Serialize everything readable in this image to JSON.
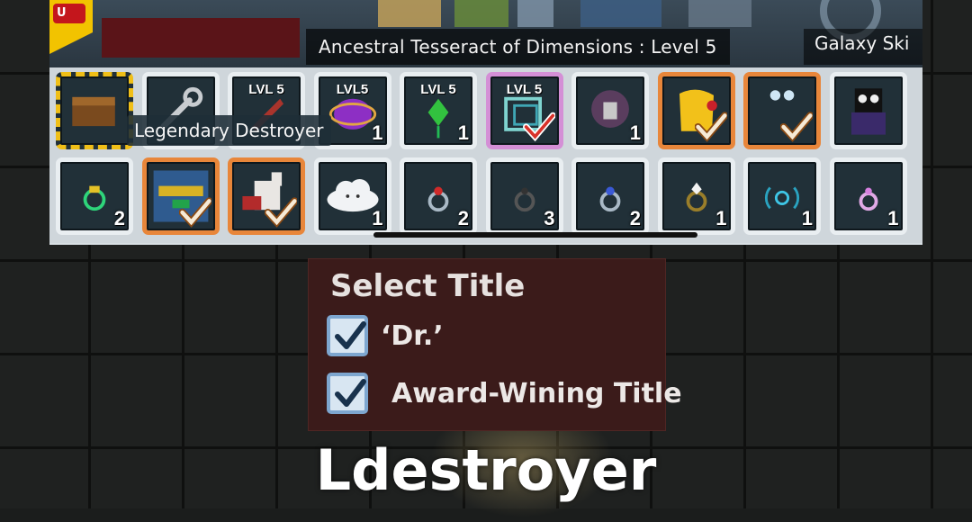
{
  "colors": {
    "slot_frame_default": "#e9eef1",
    "slot_frame_equipped": "#e8863a",
    "slot_frame_rare": "#d48fd6",
    "slot_frame_selected": "#f0bf17",
    "title_panel_bg": "#3b1b1a",
    "checkbox_blue": "#7da6cf"
  },
  "inventory": {
    "header_item": "Ancestral Tesseract of Dimensions : Level 5",
    "header_item_2": "Galaxy Ski",
    "flag_text": "U",
    "hover_tooltip": "Legendary Destroyer",
    "row1": [
      {
        "icon": "treasure-chest-icon",
        "qty": "",
        "lvl": "",
        "state": "selected"
      },
      {
        "icon": "wrench-icon",
        "qty": "",
        "lvl": "",
        "state": "default"
      },
      {
        "icon": "red-blade-icon",
        "qty": "",
        "lvl": "LVL 5",
        "state": "default"
      },
      {
        "icon": "purple-crystal-icon",
        "qty": "1",
        "lvl": "LVL5",
        "state": "default"
      },
      {
        "icon": "green-crystal-icon",
        "qty": "1",
        "lvl": "LVL 5",
        "state": "default"
      },
      {
        "icon": "tesseract-icon",
        "qty": "",
        "lvl": "LVL 5",
        "state": "rare"
      },
      {
        "icon": "ghost-icon",
        "qty": "1",
        "lvl": "",
        "state": "default"
      },
      {
        "icon": "golden-wings-icon",
        "qty": "",
        "lvl": "",
        "state": "equipped"
      },
      {
        "icon": "goggles-icon",
        "qty": "",
        "lvl": "",
        "state": "equipped"
      },
      {
        "icon": "shadow-figure-icon",
        "qty": "",
        "lvl": "",
        "state": "default"
      }
    ],
    "row2": [
      {
        "icon": "green-ring-icon",
        "qty": "2",
        "state": "default"
      },
      {
        "icon": "machine-icon",
        "qty": "",
        "state": "equipped"
      },
      {
        "icon": "llama-icon",
        "qty": "",
        "state": "equipped"
      },
      {
        "icon": "cloud-icon",
        "qty": "1",
        "state": "default"
      },
      {
        "icon": "red-ring-icon",
        "qty": "2",
        "state": "default"
      },
      {
        "icon": "dark-ring-icon",
        "qty": "3",
        "state": "default"
      },
      {
        "icon": "blue-ring-icon",
        "qty": "2",
        "state": "default"
      },
      {
        "icon": "diamond-ring-icon",
        "qty": "1",
        "state": "default"
      },
      {
        "icon": "signal-ring-icon",
        "qty": "1",
        "state": "default"
      },
      {
        "icon": "pink-ring-icon",
        "qty": "1",
        "state": "default"
      }
    ]
  },
  "select_title": {
    "heading": "Select Title",
    "options": [
      {
        "label": "‘Dr.’",
        "checked": true
      },
      {
        "label": "Award-Wining Title",
        "checked": true
      }
    ]
  },
  "player": {
    "name": "Ldestroyer"
  }
}
